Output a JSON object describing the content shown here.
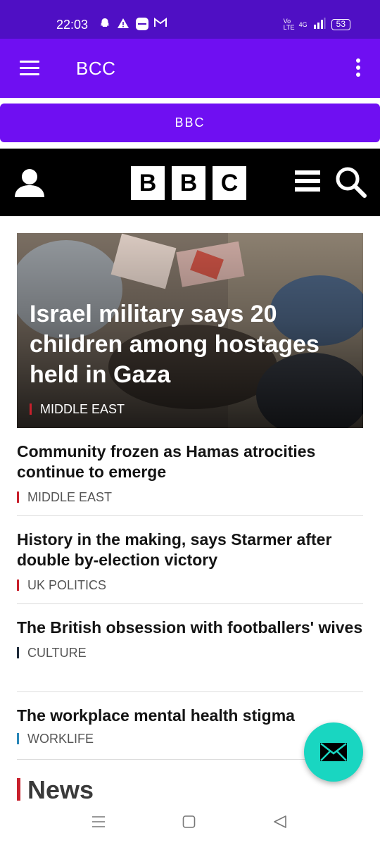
{
  "status_bar": {
    "time": "22:03",
    "network": "4G",
    "volte": "Vo LTE",
    "battery": "53",
    "icons": [
      "snapchat-icon",
      "alert-icon",
      "app-icon",
      "gmail-icon",
      "signal-icon"
    ]
  },
  "app_bar": {
    "title": "BCC",
    "menu_icon": "hamburger-icon",
    "more_icon": "more-vertical-icon",
    "background": "#6f0ff2"
  },
  "bbc_button": {
    "label": "BBC"
  },
  "bbc_header": {
    "logo_letters": [
      "B",
      "B",
      "C"
    ],
    "icons": [
      "user-icon",
      "menu-icon",
      "search-icon"
    ]
  },
  "hero": {
    "title": "Israel military says 20 children among hostages held in Gaza",
    "tag": "MIDDLE EAST",
    "tag_color": "#c8202c"
  },
  "stories": [
    {
      "title": "Community frozen as Hamas atrocities continue to emerge",
      "tag": "MIDDLE EAST",
      "tag_color": "#c8202c"
    },
    {
      "title": "History in the making, says Starmer after double by-election victory",
      "tag": "UK POLITICS",
      "tag_color": "#c8202c"
    },
    {
      "title": "The British obsession with footballers' wives",
      "tag": "CULTURE",
      "tag_color": "#1f2b3a"
    },
    {
      "title": "The workplace mental health stigma",
      "tag": "WORKLIFE",
      "tag_color": "#2a87b8"
    }
  ],
  "section_heading": "News",
  "fab": {
    "icon": "mail-icon",
    "color": "#19d6c1"
  },
  "nav_bar": {
    "icons": [
      "recents-icon",
      "home-icon",
      "back-icon"
    ]
  }
}
